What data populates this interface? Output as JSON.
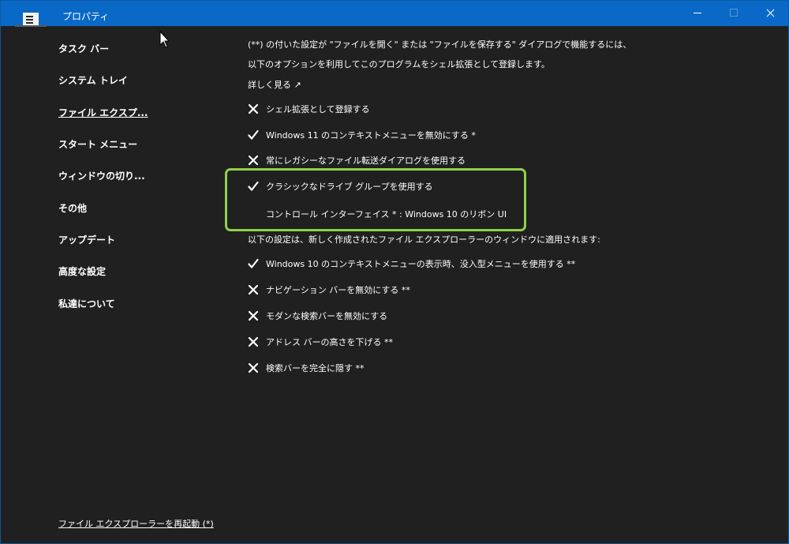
{
  "window": {
    "title": "プロパティ"
  },
  "sidebar": {
    "items": [
      {
        "label": "タスク バー"
      },
      {
        "label": "システム トレイ"
      },
      {
        "label": "ファイル エクスプ..."
      },
      {
        "label": "スタート メニュー"
      },
      {
        "label": "ウィンドウの切り..."
      },
      {
        "label": "その他"
      },
      {
        "label": "アップデート"
      },
      {
        "label": "高度な設定"
      },
      {
        "label": "私達について"
      }
    ],
    "restart_link": "ファイル エクスプローラーを再起動 (*)"
  },
  "main": {
    "intro_line1": "(**) の付いた設定が \"ファイルを開く\" または \"ファイルを保存する\" ダイアログで機能するには、",
    "intro_line2": "以下のオプションを利用してこのプログラムをシェル拡張として登録します。",
    "learn_more": "詳しく見る ↗",
    "options": [
      {
        "label": "シェル拡張として登録する",
        "checked": false
      },
      {
        "label": "Windows 11 のコンテキストメニューを無効にする *",
        "checked": true
      },
      {
        "label": "常にレガシーなファイル転送ダイアログを使用する",
        "checked": false
      },
      {
        "label": "クラシックなドライブ グループを使用する",
        "checked": true
      }
    ],
    "control_interface": "コントロール インターフェイス * : Windows 10 のリボン UI",
    "section2_intro": "以下の設定は、新しく作成されたファイル エクスプローラーのウィンドウに適用されます:",
    "options2": [
      {
        "label": "Windows 10 のコンテキストメニューの表示時、没入型メニューを使用する **",
        "checked": true
      },
      {
        "label": "ナビゲーション バーを無効にする **",
        "checked": false
      },
      {
        "label": "モダンな検索バーを無効にする",
        "checked": false
      },
      {
        "label": "アドレス バーの高さを下げる **",
        "checked": false
      },
      {
        "label": "検索バーを完全に隠す **",
        "checked": false
      }
    ]
  },
  "colors": {
    "titlebar": "#0a69c6",
    "background": "#202020",
    "highlight": "#8ed14a"
  }
}
